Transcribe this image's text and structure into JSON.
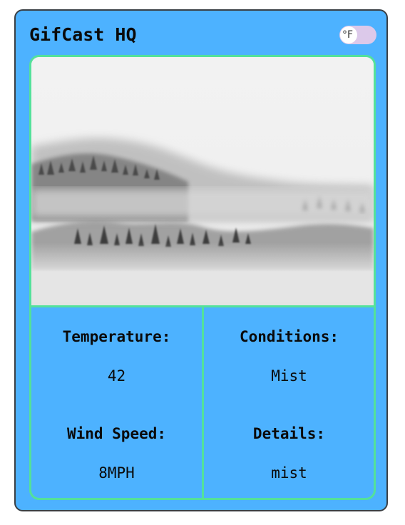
{
  "app": {
    "title": "GifCast HQ"
  },
  "unit_toggle": {
    "label": "°F",
    "on": false
  },
  "weather_image": {
    "description_icon": "misty-forest-image"
  },
  "stats": {
    "temperature": {
      "label": "Temperature:",
      "value": "42"
    },
    "conditions": {
      "label": "Conditions:",
      "value": "Mist"
    },
    "wind_speed": {
      "label": "Wind Speed:",
      "value": "8MPH"
    },
    "details": {
      "label": "Details:",
      "value": "mist"
    }
  },
  "colors": {
    "card_background": "#4db2ff",
    "card_border": "#3a3f44",
    "panel_border": "#54e19a",
    "toggle_track": "#dcc9ea",
    "toggle_knob": "#ffffff"
  }
}
